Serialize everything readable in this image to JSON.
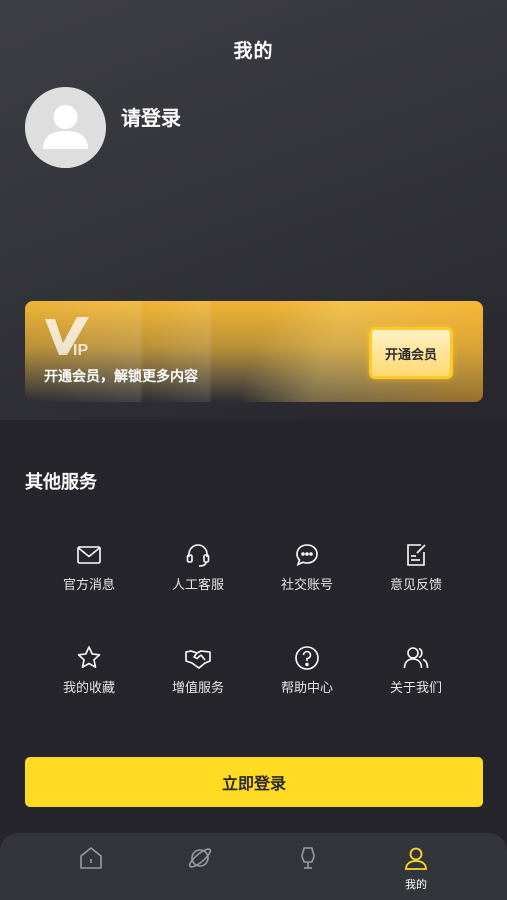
{
  "header": {
    "title": "我的"
  },
  "profile": {
    "login_prompt": "请登录"
  },
  "vip": {
    "logo_text": "VIP",
    "promo_text": "开通会员，解锁更多内容",
    "button_label": "开通会员",
    "accent_color": "#ffca28"
  },
  "services": {
    "section_title": "其他服务",
    "items": [
      {
        "label": "官方消息",
        "icon": "envelope-icon"
      },
      {
        "label": "人工客服",
        "icon": "headset-icon"
      },
      {
        "label": "社交账号",
        "icon": "chat-bubble-icon"
      },
      {
        "label": "意见反馈",
        "icon": "feedback-edit-icon"
      },
      {
        "label": "我的收藏",
        "icon": "star-icon"
      },
      {
        "label": "增值服务",
        "icon": "handshake-icon"
      },
      {
        "label": "帮助中心",
        "icon": "question-circle-icon"
      },
      {
        "label": "关于我们",
        "icon": "users-icon"
      }
    ]
  },
  "login_button": {
    "label": "立即登录",
    "color": "#ffdb23"
  },
  "tabbar": {
    "tabs": [
      {
        "label": "",
        "icon": "home-icon",
        "active": false
      },
      {
        "label": "",
        "icon": "planet-icon",
        "active": false
      },
      {
        "label": "",
        "icon": "mannequin-icon",
        "active": false
      },
      {
        "label": "我的",
        "icon": "person-icon",
        "active": true
      }
    ],
    "active_color": "#ffdb23"
  }
}
